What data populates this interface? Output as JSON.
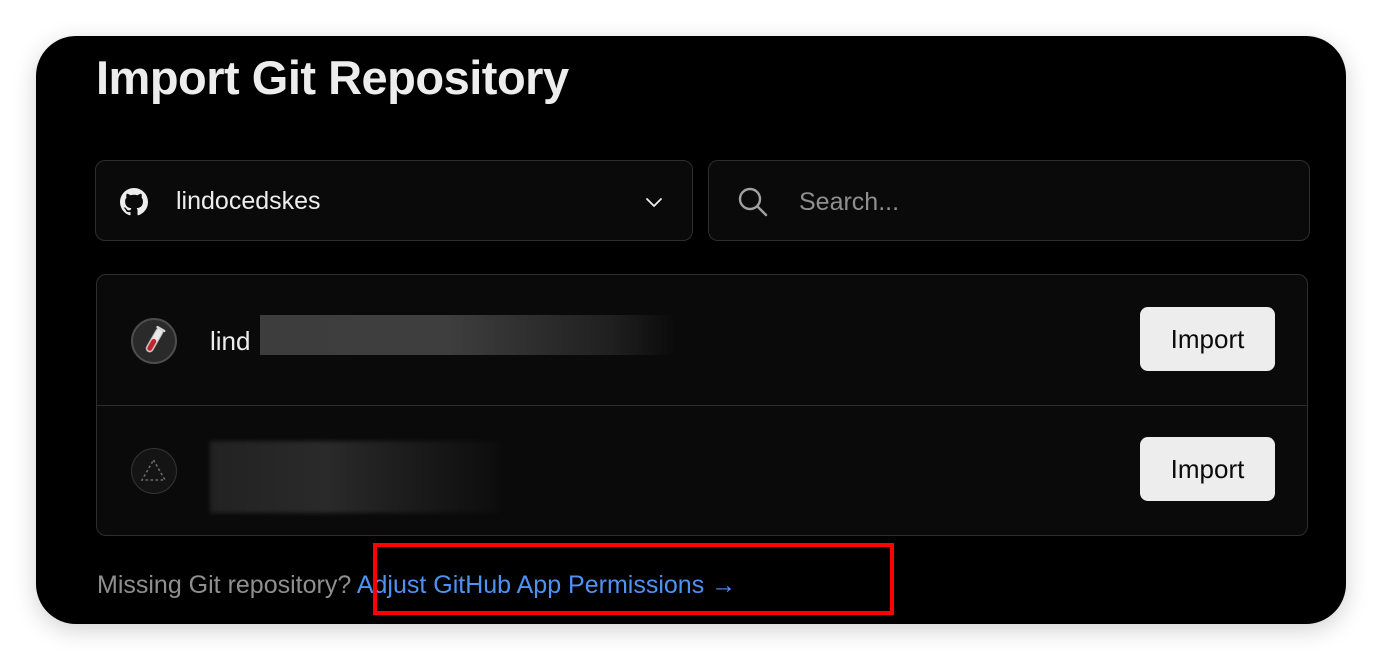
{
  "page": {
    "title": "Import Git Repository"
  },
  "account_selector": {
    "provider_icon": "github-icon",
    "account_name": "lindocedskes",
    "dropdown_icon": "chevron-down-icon"
  },
  "search": {
    "icon": "search-icon",
    "placeholder": "Search...",
    "value": ""
  },
  "repositories": [
    {
      "avatar_icon": "test-tube-icon",
      "name_visible": "lind",
      "name_redacted": true,
      "import_label": "Import"
    },
    {
      "avatar_icon": "triangle-outline-icon",
      "name_visible": "",
      "name_redacted": true,
      "import_label": "Import"
    }
  ],
  "footer": {
    "question": "Missing Git repository?",
    "link_label": "Adjust GitHub App Permissions →"
  },
  "colors": {
    "background": "#000000",
    "panel": "#0a0a0a",
    "border": "#2e2e2e",
    "text": "#ededed",
    "muted": "#8f8f8f",
    "link": "#4e92f2",
    "button_bg": "#ededed",
    "highlight": "#ff0000"
  }
}
